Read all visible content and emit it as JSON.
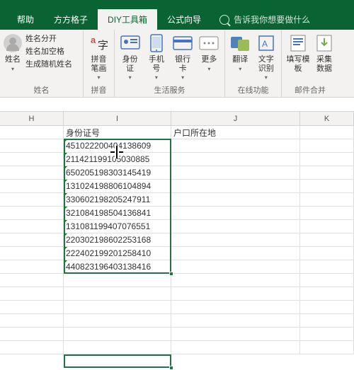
{
  "tabs": {
    "help": "帮助",
    "ffgz": "方方格子",
    "diy": "DIY工具箱",
    "gsxd": "公式向导"
  },
  "search_placeholder": "告诉我你想要做什么",
  "ribbon": {
    "name_group": {
      "btn": "姓名",
      "opt1": "姓名分开",
      "opt2": "姓名加空格",
      "opt3": "生成随机姓名",
      "label": "姓名"
    },
    "pinyin": {
      "btn": "拼音笔画",
      "label": "拼音"
    },
    "life": {
      "id": "身份证",
      "phone": "手机号",
      "bank": "银行卡",
      "more": "更多",
      "label": "生活服务"
    },
    "online": {
      "trans": "翻译",
      "ocr": "文字识别",
      "label": "在线功能"
    },
    "mail": {
      "fill": "填写模板",
      "coll": "采集数据",
      "label": "邮件合并"
    }
  },
  "columns": {
    "h": "H",
    "i": "I",
    "j": "J",
    "k": "K"
  },
  "chart_data": {
    "type": "table",
    "headers": [
      "身份证号",
      "户口所在地"
    ],
    "rows": [
      [
        "451022200404138609",
        ""
      ],
      [
        "211421199105030885",
        ""
      ],
      [
        "650205198303145419",
        ""
      ],
      [
        "131024198806104894",
        ""
      ],
      [
        "330602198205247911",
        ""
      ],
      [
        "321084198504136841",
        ""
      ],
      [
        "131081199407076551",
        ""
      ],
      [
        "220302198602253168",
        ""
      ],
      [
        "222402199201258410",
        ""
      ],
      [
        "440823196403138416",
        ""
      ]
    ]
  }
}
